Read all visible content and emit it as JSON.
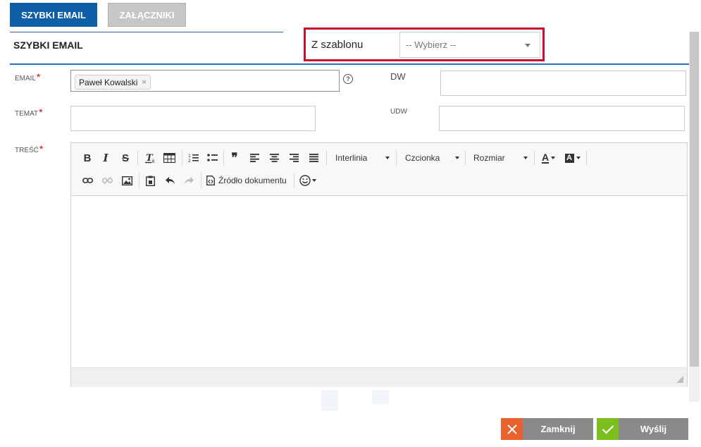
{
  "tabs": [
    {
      "label": "SZYBKI EMAIL",
      "active": true
    },
    {
      "label": "ZAŁĄCZNIKI",
      "active": false
    }
  ],
  "section": {
    "title": "SZYBKI EMAIL"
  },
  "template": {
    "label": "Z szablonu",
    "selected": "-- Wybierz --"
  },
  "fields": {
    "email": {
      "label": "EMAIL",
      "required": "*",
      "chip": "Paweł Kowalski",
      "chip_remove": "×",
      "help": "?"
    },
    "dw": {
      "label": "DW",
      "value": ""
    },
    "temat": {
      "label": "TEMAT",
      "required": "*",
      "value": ""
    },
    "udw": {
      "label": "UDW",
      "value": ""
    },
    "tresc": {
      "label": "TREŚĆ",
      "required": "*"
    }
  },
  "toolbar": {
    "interlinia": "Interlinia",
    "czcionka": "Czcionka",
    "rozmiar": "Rozmiar",
    "source": "Źródło dokumentu",
    "bold": "B",
    "italic": "I",
    "strike": "S",
    "quote": "❞",
    "text_color": "A",
    "bg_color": "A"
  },
  "buttons": {
    "close": "Zamknij",
    "send": "Wyślij"
  },
  "colors": {
    "primary": "#0f5ea8",
    "required": "#d0021b",
    "highlight": "#c8102e",
    "close_icon_bg": "#e9622e",
    "send_icon_bg": "#7bbf1f",
    "button_gray": "#8a8a8a"
  }
}
